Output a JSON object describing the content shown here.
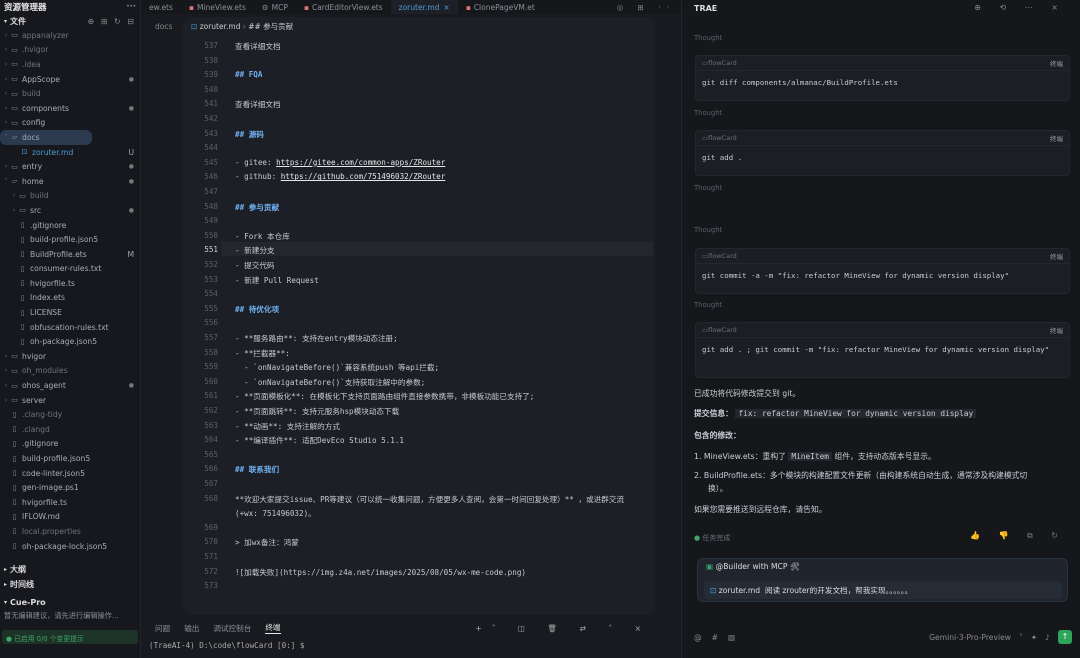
{
  "explorer": {
    "title": "资源管理器",
    "section": "文件",
    "items": [
      {
        "label": "appanalyzer",
        "kind": "folder",
        "dim": true
      },
      {
        "label": ".hvigor",
        "kind": "folder",
        "dim": true
      },
      {
        "label": ".idea",
        "kind": "folder",
        "dim": true
      },
      {
        "label": "AppScope",
        "kind": "folder",
        "dot": true
      },
      {
        "label": "build",
        "kind": "folder",
        "dim": true
      },
      {
        "label": "components",
        "kind": "folder",
        "dot": true
      },
      {
        "label": "config",
        "kind": "folder"
      },
      {
        "label": "docs",
        "kind": "folder-open",
        "selected": true
      },
      {
        "label": "zoruter.md",
        "kind": "md",
        "active": true,
        "badge": "U"
      },
      {
        "label": "entry",
        "kind": "folder",
        "dot": true
      },
      {
        "label": "home",
        "kind": "folder-open",
        "dot": true
      },
      {
        "label": "build",
        "kind": "folder",
        "dim": true,
        "indent": 1
      },
      {
        "label": "src",
        "kind": "folder",
        "indent": 1,
        "dot": true
      },
      {
        "label": ".gitignore",
        "kind": "file",
        "indent": 1
      },
      {
        "label": "build-profile.json5",
        "kind": "file",
        "indent": 1
      },
      {
        "label": "BuildProfile.ets",
        "kind": "file",
        "indent": 1,
        "badge": "M"
      },
      {
        "label": "consumer-rules.txt",
        "kind": "file",
        "indent": 1
      },
      {
        "label": "hvigorfile.ts",
        "kind": "file",
        "indent": 1
      },
      {
        "label": "Index.ets",
        "kind": "file",
        "indent": 1
      },
      {
        "label": "LICENSE",
        "kind": "file",
        "indent": 1
      },
      {
        "label": "obfuscation-rules.txt",
        "kind": "file",
        "indent": 1
      },
      {
        "label": "oh-package.json5",
        "kind": "file",
        "indent": 1
      },
      {
        "label": "hvigor",
        "kind": "folder"
      },
      {
        "label": "oh_modules",
        "kind": "folder",
        "dim": true
      },
      {
        "label": "ohos_agent",
        "kind": "folder",
        "dot": true
      },
      {
        "label": "server",
        "kind": "folder"
      },
      {
        "label": ".clang-tidy",
        "kind": "file",
        "dim": true
      },
      {
        "label": ".clangd",
        "kind": "file",
        "dim": true
      },
      {
        "label": ".gitignore",
        "kind": "file"
      },
      {
        "label": "build-profile.json5",
        "kind": "file"
      },
      {
        "label": "code-linter.json5",
        "kind": "file"
      },
      {
        "label": "gen-image.ps1",
        "kind": "file"
      },
      {
        "label": "hvigorfile.ts",
        "kind": "file"
      },
      {
        "label": "IFLOW.md",
        "kind": "file"
      },
      {
        "label": "local.properties",
        "kind": "file",
        "dim": true
      },
      {
        "label": "oh-package-lock.json5",
        "kind": "file"
      }
    ],
    "outline": "大纲",
    "timeline": "时间线",
    "cuepro": "Cue-Pro",
    "cuepro_hint": "暂无编辑建议，请先进行编辑操作...",
    "cuepro_status": "已启用 0/0 个变更提示"
  },
  "editor": {
    "tabs": [
      {
        "label": "ew.ets",
        "active": false
      },
      {
        "label": "MineView.ets",
        "active": false
      },
      {
        "label": "MCP",
        "active": false
      },
      {
        "label": "CardEditorView.ets",
        "active": false
      },
      {
        "label": "zoruter.md",
        "active": true
      },
      {
        "label": "ClonePageVM.et",
        "active": false
      }
    ],
    "breadcrumb_root": "docs",
    "breadcrumb_file": "zoruter.md",
    "breadcrumb_section": "## 参与贡献",
    "lines": [
      {
        "n": "537",
        "t": "查看详细文档"
      },
      {
        "n": "538",
        "t": ""
      },
      {
        "n": "539",
        "t": "## FQA",
        "h": true
      },
      {
        "n": "540",
        "t": ""
      },
      {
        "n": "541",
        "t": "查看详细文档"
      },
      {
        "n": "542",
        "t": ""
      },
      {
        "n": "543",
        "t": "## 源码",
        "h": true
      },
      {
        "n": "544",
        "t": ""
      },
      {
        "n": "545",
        "t": "- gitee: ",
        "url": "https://gitee.com/common-apps/ZRouter"
      },
      {
        "n": "546",
        "t": "- github: ",
        "url": "https://github.com/751496032/ZRouter"
      },
      {
        "n": "547",
        "t": ""
      },
      {
        "n": "548",
        "t": "## 参与贡献",
        "h": true
      },
      {
        "n": "549",
        "t": ""
      },
      {
        "n": "550",
        "t": "- Fork 本仓库"
      },
      {
        "n": "551",
        "t": "- 新建分支",
        "cur": true
      },
      {
        "n": "552",
        "t": "- 提交代码"
      },
      {
        "n": "553",
        "t": "- 新建 Pull Request"
      },
      {
        "n": "554",
        "t": ""
      },
      {
        "n": "555",
        "t": "## 待优化项",
        "h": true
      },
      {
        "n": "556",
        "t": ""
      },
      {
        "n": "557",
        "t": "- **服务路由**: 支持在entry模块动态注册;"
      },
      {
        "n": "558",
        "t": "- **拦截器**:"
      },
      {
        "n": "559",
        "t": "  - `onNavigateBefore()`兼容系统push 等api拦截;"
      },
      {
        "n": "560",
        "t": "  - `onNavigateBefore()`支持获取注解中的参数;"
      },
      {
        "n": "561",
        "t": "- **页面模板化**: 在模板化下支持页面路由组件直接参数携带，非模板功能已支持了;"
      },
      {
        "n": "562",
        "t": "- **页面跳转**: 支持元服务hsp模块动态下载"
      },
      {
        "n": "563",
        "t": "- **动画**: 支持注解的方式"
      },
      {
        "n": "564",
        "t": "- **编译插件**: 适配DevEco Studio 5.1.1"
      },
      {
        "n": "565",
        "t": ""
      },
      {
        "n": "566",
        "t": "## 联系我们",
        "h": true
      },
      {
        "n": "567",
        "t": ""
      },
      {
        "n": "568",
        "t": "**欢迎大家提交issue、PR等建议（可以统一收集问题，方便更多人查阅，会第一时间回复处理）** ，或进群交流"
      },
      {
        "n": "",
        "t": "(+wx: 751496032)。"
      },
      {
        "n": "569",
        "t": ""
      },
      {
        "n": "570",
        "t": "> 加wx备注：鸿蒙"
      },
      {
        "n": "571",
        "t": ""
      },
      {
        "n": "572",
        "t": "![加载失败](https://img.z4a.net/images/2025/08/05/wx-me-code.png)"
      },
      {
        "n": "573",
        "t": ""
      }
    ],
    "terminal_tabs": [
      {
        "label": "问题",
        "active": false
      },
      {
        "label": "输出",
        "active": false
      },
      {
        "label": "调试控制台",
        "active": false
      },
      {
        "label": "终端",
        "active": true
      }
    ],
    "terminal_prompt": "(TraeAI-4) D:\\code\\flowCard [0:] $"
  },
  "chat": {
    "title": "TRAE",
    "thought": "Thought",
    "card_label": "flowCard",
    "terminal_label": "终端",
    "commands": [
      "git diff components/almanac/BuildProfile.ets",
      "git add .",
      "git commit -a -m \"fix: refactor MineView for dynamic version display\"",
      "git add . ; git commit -m \"fix: refactor MineView for dynamic version display\""
    ],
    "summary": "已成功将代码修改提交到 git。",
    "commit_label": "提交信息：",
    "commit_msg": "fix: refactor MineView for dynamic version display",
    "changes_title": "包含的修改：",
    "change1_prefix": "1. MineView.ets：重构了",
    "change1_code": "MineItem",
    "change1_suffix": "组件，支持动态版本号显示。",
    "change2": "2. BuildProfile.ets：多个模块的构建配置文件更新（由构建系统自动生成，通常涉及构建模式切",
    "change2b": "换）。",
    "closing": "如果您需要推送到远程仓库，请告知。",
    "done": "任务完成",
    "mcp_title": "@Builder with MCP 🛠",
    "mcp_file": "zoruter.md",
    "mcp_prompt": "阅读 zrouter的开发文档，帮我实现。。。。。。",
    "model": "Gemini-3-Pro-Preview",
    "at_sym": "@",
    "hash_sym": "#"
  }
}
